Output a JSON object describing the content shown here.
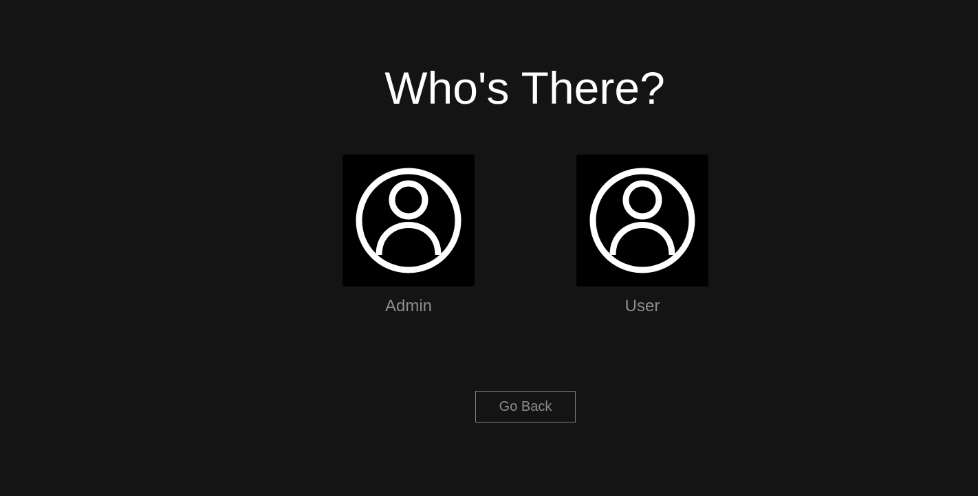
{
  "header": {
    "title": "Who's There?"
  },
  "profiles": [
    {
      "name": "Admin",
      "icon": "user-circle-icon"
    },
    {
      "name": "User",
      "icon": "user-circle-icon"
    }
  ],
  "actions": {
    "go_back_label": "Go Back"
  },
  "colors": {
    "background": "#141414",
    "title": "#ffffff",
    "label": "#8c8c8c",
    "avatar_bg": "#000000",
    "button_border": "#808080"
  }
}
